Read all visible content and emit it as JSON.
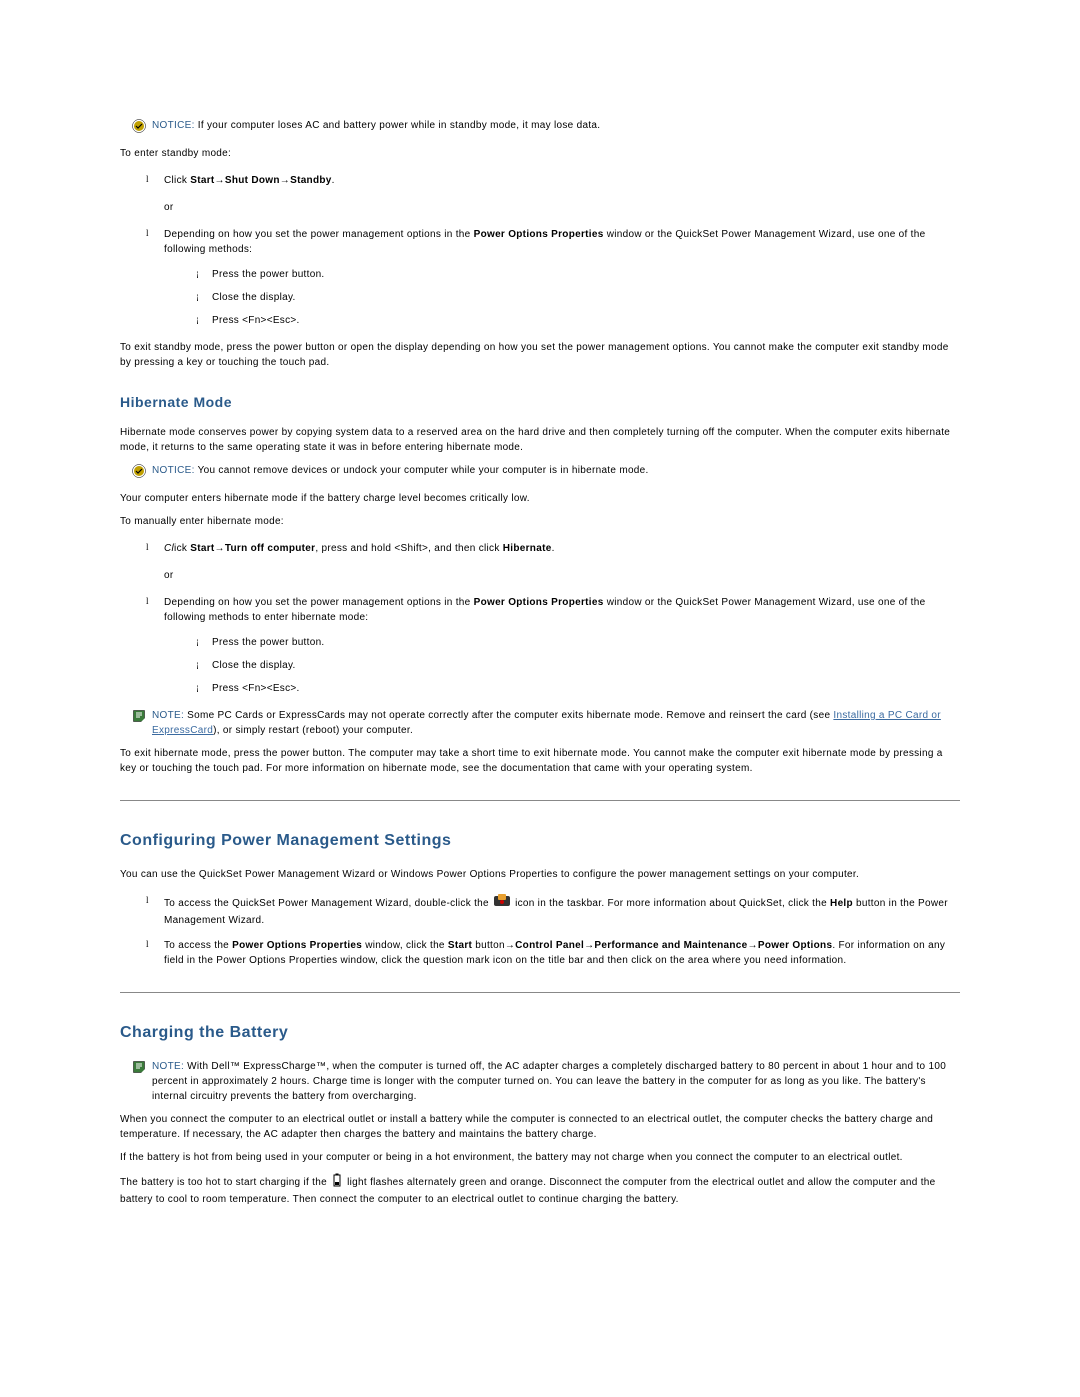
{
  "notice1": {
    "label": "NOTICE:",
    "text": " If your computer loses AC and battery power while in standby mode, it may lose data."
  },
  "standby": {
    "intro": "To enter standby mode:",
    "item1_pre": "Click ",
    "item1_b1": "Start",
    "item1_arrow1": "→",
    "item1_b2": "Shut Down",
    "item1_arrow2": "→",
    "item1_b3": "Standby",
    "item1_post": ".",
    "or": "or",
    "item2_pre": "Depending on how you set the power management options in the ",
    "item2_b1": "Power Options Properties",
    "item2_mid": " window or the QuickSet Power Management Wizard, use one of the following methods:",
    "sub1": "Press the power button.",
    "sub2": "Close the display.",
    "sub3": "Press <Fn><Esc>.",
    "exit": "To exit standby mode, press the power button or open the display depending on how you set the power management options. You cannot make the computer exit standby mode by pressing a key or touching the touch pad."
  },
  "hibernate": {
    "title": "Hibernate Mode",
    "p1": "Hibernate mode conserves power by copying system data to a reserved area on the hard drive and then completely turning off the computer. When the computer exits hibernate mode, it returns to the same operating state it was in before entering hibernate mode.",
    "notice_label": "NOTICE:",
    "notice_text": " You cannot remove devices or undock your computer while your computer is in hibernate mode.",
    "p2": "Your computer enters hibernate mode if the battery charge level becomes critically low.",
    "p3": "To manually enter hibernate mode:",
    "item1_pre_italic": "Cl",
    "item1_pre": "ick ",
    "item1_b1": "Start",
    "item1_arrow1": "→",
    "item1_b2": "Turn off computer",
    "item1_mid": ", press and hold <Shift>, and then click ",
    "item1_b3": "Hibernate",
    "item1_post": ".",
    "or": "or",
    "item2_pre": "Depending on how you set the power management options in the ",
    "item2_b1": "Power Options Properties",
    "item2_mid": " window or the QuickSet Power Management Wizard, use one of the following methods to enter hibernate mode:",
    "sub1": "Press the power button.",
    "sub2": "Close the display.",
    "sub3": "Press <Fn><Esc>.",
    "note_label": "NOTE:",
    "note_text_pre": " Some PC Cards or ExpressCards may not operate correctly after the computer exits hibernate mode. Remove and reinsert the card (see ",
    "note_link": "Installing a PC Card or ExpressCard",
    "note_text_post": "), or simply restart (reboot) your computer.",
    "exit": "To exit hibernate mode, press the power button. The computer may take a short time to exit hibernate mode. You cannot make the computer exit hibernate mode by pressing a key or touching the touch pad. For more information on hibernate mode, see the documentation that came with your operating system."
  },
  "config": {
    "title": "Configuring Power Management Settings",
    "p1": "You can use the QuickSet Power Management Wizard or Windows Power Options Properties to configure the power management settings on your computer.",
    "item1_pre": "To access the QuickSet Power Management Wizard, double-click the ",
    "item1_post": " icon in the taskbar. For more information about QuickSet, click the ",
    "item1_b1": "Help",
    "item1_end": " button in the Power Management Wizard.",
    "item2_pre": "To access the ",
    "item2_b1": "Power Options Properties",
    "item2_mid1": " window, click the ",
    "item2_b2": "Start",
    "item2_mid2": " button→",
    "item2_b3": "Control Panel",
    "item2_arrow1": "→",
    "item2_b4": "Performance and Maintenance",
    "item2_arrow2": "→",
    "item2_b5": "Power Options",
    "item2_mid3": ". For information on any field in the Power Options Properties window, click the question mark icon on the title bar and then click on the area where you need information."
  },
  "charging": {
    "title": "Charging the Battery",
    "note_label": "NOTE:",
    "note_text": " With Dell™ ExpressCharge™, when the computer is turned off, the AC adapter charges a completely discharged battery to 80 percent in about 1 hour and to 100 percent in approximately 2 hours. Charge time is longer with the computer turned on. You can leave the battery in the computer for as long as you like. The battery's internal circuitry prevents the battery from overcharging.",
    "p1": "When you connect the computer to an electrical outlet or install a battery while the computer is connected to an electrical outlet, the computer checks the battery charge and temperature. If necessary, the AC adapter then charges the battery and maintains the battery charge.",
    "p2": "If the battery is hot from being used in your computer or being in a hot environment, the battery may not charge when you connect the computer to an electrical outlet.",
    "p3_pre": "The battery is too hot to start charging if the ",
    "p3_post": " light flashes alternately green and orange. Disconnect the computer from the electrical outlet and allow the computer and the battery to cool to room temperature. Then connect the computer to an electrical outlet to continue charging the battery."
  }
}
